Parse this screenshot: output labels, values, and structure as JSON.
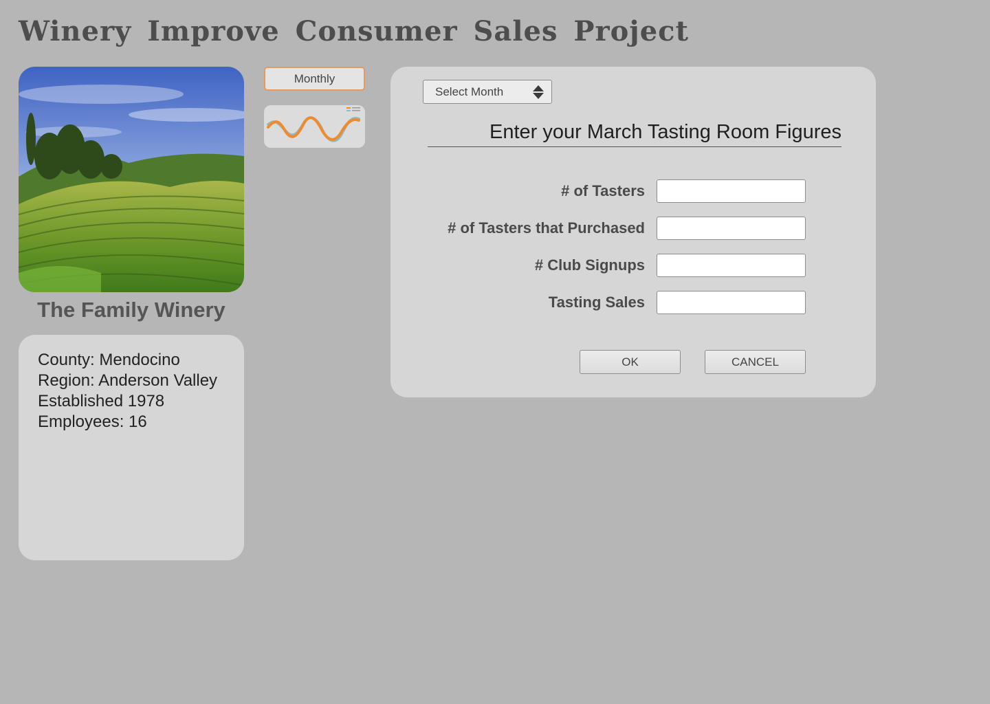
{
  "app": {
    "title": "Winery Improve Consumer Sales Project"
  },
  "winery": {
    "name": "The Family Winery",
    "photo": "vineyard-landscape",
    "info": [
      "County: Mendocino",
      "Region: Anderson Valley",
      "Established 1978",
      "Employees: 16"
    ]
  },
  "nav": {
    "monthly_label": "Monthly",
    "trend_thumbnail": "line-chart-thumbnail",
    "accent_color": "#e89a5c"
  },
  "form": {
    "month_select": {
      "value": "Select Month",
      "icon": "updown-arrows-icon"
    },
    "heading": "Enter your March Tasting Room Figures",
    "fields": [
      {
        "label": "# of Tasters",
        "value": ""
      },
      {
        "label": "# of Tasters that Purchased",
        "value": ""
      },
      {
        "label": "# Club Signups",
        "value": ""
      },
      {
        "label": "Tasting Sales",
        "value": ""
      }
    ],
    "ok_label": "OK",
    "cancel_label": "CANCEL"
  },
  "colors": {
    "background": "#b6b6b6",
    "panel": "#d6d6d6",
    "series_primary": "#f08a2c",
    "series_secondary": "#8fbcc0"
  }
}
